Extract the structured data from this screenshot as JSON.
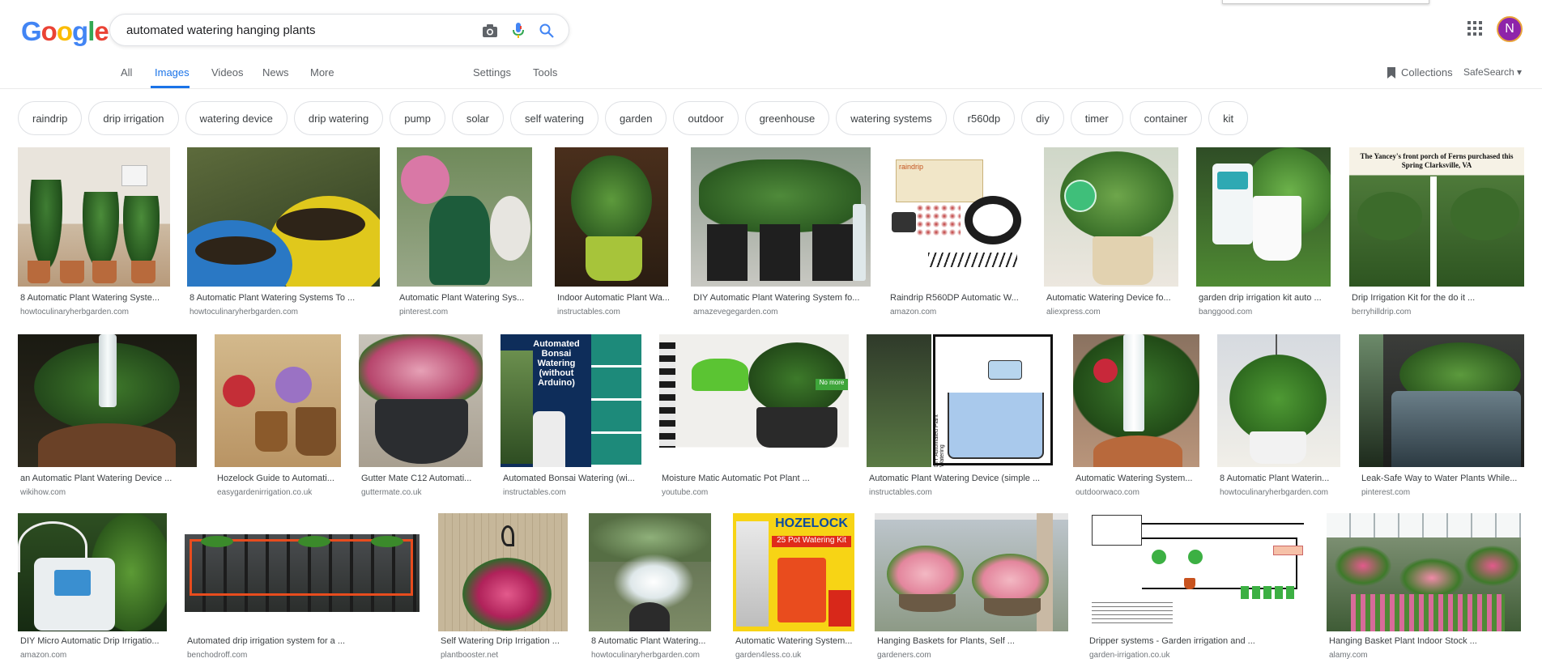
{
  "logo": "Google",
  "search": {
    "value": "automated watering hanging plants"
  },
  "icons": {
    "camera": "camera-icon",
    "mic": "mic-icon",
    "search": "search-icon",
    "apps": "apps-grid-icon"
  },
  "account": {
    "initial": "N"
  },
  "tabs": [
    {
      "label": "All",
      "active": false
    },
    {
      "label": "Images",
      "active": true
    },
    {
      "label": "Videos",
      "active": false
    },
    {
      "label": "News",
      "active": false
    },
    {
      "label": "More",
      "active": false
    }
  ],
  "tools": {
    "settings": "Settings",
    "tools": "Tools"
  },
  "right_links": {
    "collections": "Collections",
    "safesearch": "SafeSearch ▾"
  },
  "chips": [
    "raindrip",
    "drip irrigation",
    "watering device",
    "drip watering",
    "pump",
    "solar",
    "self watering",
    "garden",
    "outdoor",
    "greenhouse",
    "watering systems",
    "r560dp",
    "diy",
    "timer",
    "container",
    "kit"
  ],
  "results": [
    {
      "caption": "8 Automatic Plant Watering Syste...",
      "source": "howtoculinaryherbgarden.com"
    },
    {
      "caption": "8 Automatic Plant Watering Systems To ...",
      "source": "howtoculinaryherbgarden.com"
    },
    {
      "caption": "Automatic Plant Watering Sys...",
      "source": "pinterest.com"
    },
    {
      "caption": "Indoor Automatic Plant Wa...",
      "source": "instructables.com"
    },
    {
      "caption": "DIY Automatic Plant Watering System fo...",
      "source": "amazevegegarden.com"
    },
    {
      "caption": "Raindrip R560DP Automatic W...",
      "source": "amazon.com"
    },
    {
      "caption": "Automatic Watering Device fo...",
      "source": "aliexpress.com"
    },
    {
      "caption": "garden drip irrigation kit auto ...",
      "source": "banggood.com"
    },
    {
      "caption": "Drip Irrigation Kit for the do it ...",
      "source": "berryhilldrip.com"
    },
    {
      "caption": "an Automatic Plant Watering Device ...",
      "source": "wikihow.com"
    },
    {
      "caption": "Hozelock Guide to Automati...",
      "source": "easygardenirrigation.co.uk"
    },
    {
      "caption": "Gutter Mate C12 Automati...",
      "source": "guttermate.co.uk"
    },
    {
      "caption": "Automated Bonsai Watering (wi...",
      "source": "instructables.com"
    },
    {
      "caption": "Moisture Matic Automatic Pot Plant ...",
      "source": "youtube.com"
    },
    {
      "caption": "Automatic Plant Watering Device (simple ...",
      "source": "instructables.com"
    },
    {
      "caption": "Automatic Watering System...",
      "source": "outdoorwaco.com"
    },
    {
      "caption": "8 Automatic Plant Waterin...",
      "source": "howtoculinaryherbgarden.com"
    },
    {
      "caption": "Leak-Safe Way to Water Plants While...",
      "source": "pinterest.com"
    },
    {
      "caption": "DIY Micro Automatic Drip Irrigatio...",
      "source": "amazon.com"
    },
    {
      "caption": "Automated drip irrigation system for a ...",
      "source": "benchodroff.com"
    },
    {
      "caption": "Self Watering Drip Irrigation ...",
      "source": "plantbooster.net"
    },
    {
      "caption": "8 Automatic Plant Watering...",
      "source": "howtoculinaryherbgarden.com"
    },
    {
      "caption": "Automatic Watering System...",
      "source": "garden4less.co.uk"
    },
    {
      "caption": "Hanging Baskets for Plants, Self ...",
      "source": "gardeners.com"
    },
    {
      "caption": "Dripper systems - Garden irrigation and ...",
      "source": "garden-irrigation.co.uk"
    },
    {
      "caption": "Hanging Basket Plant Indoor Stock ...",
      "source": "alamy.com"
    }
  ],
  "image_text": {
    "r1_9": "The Yancey's front porch of Ferns purchased this Spring Clarksville, VA",
    "r2_4": "Automated Bonsai Watering (without Arduino)",
    "r2_5": "No more",
    "r2_6": "DIY Automated Plant Watering",
    "r3_5_brand": "HOZELOCK",
    "r3_5_kit": "25 Pot Watering Kit",
    "r1_6": "raindrip"
  }
}
